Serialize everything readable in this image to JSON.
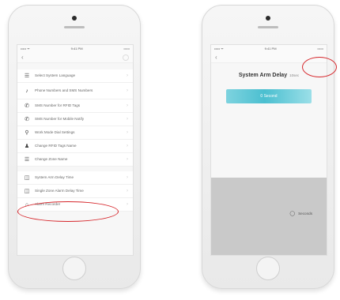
{
  "left_phone": {
    "status": {
      "carrier": "••••• ᯤ",
      "time": "9:41 PM",
      "battery": "▭▭"
    },
    "nav": {
      "back_icon": "‹",
      "more": "···"
    },
    "menu_items": [
      {
        "icon": "☰",
        "label": "Select System Language"
      },
      {
        "icon": "♪",
        "label": "Phone Numbers and SMS Numbers"
      },
      {
        "icon": "✆",
        "label": "SMS Number for RFID Tags"
      },
      {
        "icon": "✆",
        "label": "SMS Number for Mobile Notify"
      },
      {
        "icon": "⚲",
        "label": "Work Mode Dial Settings"
      },
      {
        "icon": "♟",
        "label": "Change RFID Tags Name"
      },
      {
        "icon": "☰",
        "label": "Change Zone Name"
      },
      {
        "icon": "◫",
        "label": "System Arm Delay Time"
      },
      {
        "icon": "◫",
        "label": "Single Zone Alarm Delay Time"
      },
      {
        "icon": "⌂",
        "label": "Alarm Recorder"
      }
    ]
  },
  "right_phone": {
    "status": {
      "carrier": "••••• ᯤ",
      "time": "9:41 PM",
      "battery": "▭▭"
    },
    "nav": {
      "back_icon": "‹",
      "more": "·····"
    },
    "title": "System Arm Delay",
    "title_suffix": "10sec",
    "button_label": "0 Second",
    "sheet_item": {
      "icon": "◯",
      "label": "Seconds"
    }
  },
  "colors": {
    "highlight": "#d6262b",
    "accent": "#4bbfd0"
  }
}
